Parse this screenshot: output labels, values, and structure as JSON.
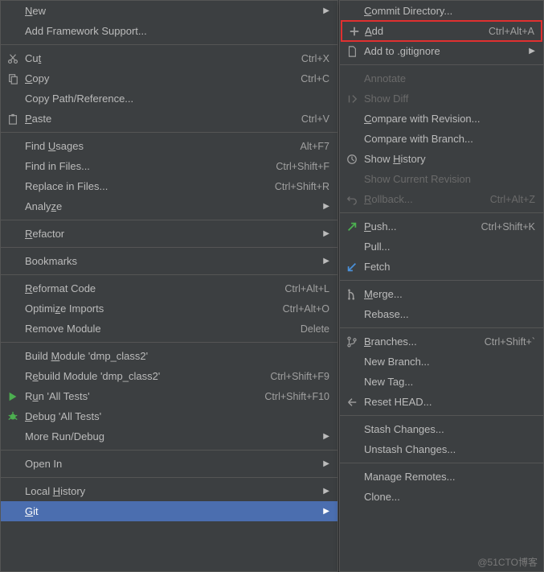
{
  "left_menu": {
    "groups": [
      [
        {
          "id": "new",
          "label": "New",
          "mnemonic": "N",
          "shortcut": "",
          "arrow": true,
          "icon": ""
        },
        {
          "id": "add-framework",
          "label": "Add Framework Support...",
          "mnemonic": "",
          "shortcut": "",
          "arrow": false,
          "icon": ""
        }
      ],
      [
        {
          "id": "cut",
          "label": "Cut",
          "mnemonic": "t",
          "shortcut": "Ctrl+X",
          "arrow": false,
          "icon": "cut"
        },
        {
          "id": "copy",
          "label": "Copy",
          "mnemonic": "C",
          "shortcut": "Ctrl+C",
          "arrow": false,
          "icon": "copy"
        },
        {
          "id": "copy-path",
          "label": "Copy Path/Reference...",
          "mnemonic": "",
          "shortcut": "",
          "arrow": false,
          "icon": ""
        },
        {
          "id": "paste",
          "label": "Paste",
          "mnemonic": "P",
          "shortcut": "Ctrl+V",
          "arrow": false,
          "icon": "paste"
        }
      ],
      [
        {
          "id": "find-usages",
          "label": "Find Usages",
          "mnemonic": "U",
          "shortcut": "Alt+F7",
          "arrow": false,
          "icon": ""
        },
        {
          "id": "find-in-files",
          "label": "Find in Files...",
          "mnemonic": "",
          "shortcut": "Ctrl+Shift+F",
          "arrow": false,
          "icon": ""
        },
        {
          "id": "replace-in-files",
          "label": "Replace in Files...",
          "mnemonic": "",
          "shortcut": "Ctrl+Shift+R",
          "arrow": false,
          "icon": ""
        },
        {
          "id": "analyze",
          "label": "Analyze",
          "mnemonic": "z",
          "shortcut": "",
          "arrow": true,
          "icon": ""
        }
      ],
      [
        {
          "id": "refactor",
          "label": "Refactor",
          "mnemonic": "R",
          "shortcut": "",
          "arrow": true,
          "icon": ""
        }
      ],
      [
        {
          "id": "bookmarks",
          "label": "Bookmarks",
          "mnemonic": "",
          "shortcut": "",
          "arrow": true,
          "icon": ""
        }
      ],
      [
        {
          "id": "reformat",
          "label": "Reformat Code",
          "mnemonic": "R",
          "shortcut": "Ctrl+Alt+L",
          "arrow": false,
          "icon": ""
        },
        {
          "id": "optimize-imports",
          "label": "Optimize Imports",
          "mnemonic": "z",
          "shortcut": "Ctrl+Alt+O",
          "arrow": false,
          "icon": ""
        },
        {
          "id": "remove-module",
          "label": "Remove Module",
          "mnemonic": "",
          "shortcut": "Delete",
          "arrow": false,
          "icon": ""
        }
      ],
      [
        {
          "id": "build-module",
          "label": "Build Module 'dmp_class2'",
          "mnemonic": "M",
          "shortcut": "",
          "arrow": false,
          "icon": ""
        },
        {
          "id": "rebuild-module",
          "label": "Rebuild Module 'dmp_class2'",
          "mnemonic": "e",
          "shortcut": "Ctrl+Shift+F9",
          "arrow": false,
          "icon": ""
        },
        {
          "id": "run-all",
          "label": "Run 'All Tests'",
          "mnemonic": "u",
          "shortcut": "Ctrl+Shift+F10",
          "arrow": false,
          "icon": "run"
        },
        {
          "id": "debug-all",
          "label": "Debug 'All Tests'",
          "mnemonic": "D",
          "shortcut": "",
          "arrow": false,
          "icon": "debug"
        },
        {
          "id": "more-run-debug",
          "label": "More Run/Debug",
          "mnemonic": "",
          "shortcut": "",
          "arrow": true,
          "icon": ""
        }
      ],
      [
        {
          "id": "open-in",
          "label": "Open In",
          "mnemonic": "",
          "shortcut": "",
          "arrow": true,
          "icon": ""
        }
      ],
      [
        {
          "id": "local-history",
          "label": "Local History",
          "mnemonic": "H",
          "shortcut": "",
          "arrow": true,
          "icon": ""
        },
        {
          "id": "git",
          "label": "Git",
          "mnemonic": "G",
          "shortcut": "",
          "arrow": true,
          "icon": "",
          "selected": true
        }
      ]
    ]
  },
  "right_menu": {
    "groups": [
      [
        {
          "id": "commit-dir",
          "label": "Commit Directory...",
          "mnemonic": "C",
          "shortcut": "",
          "arrow": false,
          "icon": ""
        },
        {
          "id": "add",
          "label": "Add",
          "mnemonic": "A",
          "shortcut": "Ctrl+Alt+A",
          "arrow": false,
          "icon": "plus",
          "highlighted": true
        },
        {
          "id": "add-gitignore",
          "label": "Add to .gitignore",
          "mnemonic": "",
          "shortcut": "",
          "arrow": true,
          "icon": "file"
        }
      ],
      [
        {
          "id": "annotate",
          "label": "Annotate",
          "mnemonic": "",
          "shortcut": "",
          "arrow": false,
          "icon": "",
          "disabled": true
        },
        {
          "id": "show-diff",
          "label": "Show Diff",
          "mnemonic": "",
          "shortcut": "",
          "arrow": false,
          "icon": "diff",
          "disabled": true
        },
        {
          "id": "compare-revision",
          "label": "Compare with Revision...",
          "mnemonic": "C",
          "shortcut": "",
          "arrow": false,
          "icon": ""
        },
        {
          "id": "compare-branch",
          "label": "Compare with Branch...",
          "mnemonic": "",
          "shortcut": "",
          "arrow": false,
          "icon": ""
        },
        {
          "id": "show-history",
          "label": "Show History",
          "mnemonic": "H",
          "shortcut": "",
          "arrow": false,
          "icon": "clock"
        },
        {
          "id": "show-current-rev",
          "label": "Show Current Revision",
          "mnemonic": "",
          "shortcut": "",
          "arrow": false,
          "icon": "",
          "disabled": true
        },
        {
          "id": "rollback",
          "label": "Rollback...",
          "mnemonic": "R",
          "shortcut": "Ctrl+Alt+Z",
          "arrow": false,
          "icon": "undo",
          "disabled": true
        }
      ],
      [
        {
          "id": "push",
          "label": "Push...",
          "mnemonic": "P",
          "shortcut": "Ctrl+Shift+K",
          "arrow": false,
          "icon": "push"
        },
        {
          "id": "pull",
          "label": "Pull...",
          "mnemonic": "",
          "shortcut": "",
          "arrow": false,
          "icon": ""
        },
        {
          "id": "fetch",
          "label": "Fetch",
          "mnemonic": "",
          "shortcut": "",
          "arrow": false,
          "icon": "fetch"
        }
      ],
      [
        {
          "id": "merge",
          "label": "Merge...",
          "mnemonic": "M",
          "shortcut": "",
          "arrow": false,
          "icon": "merge"
        },
        {
          "id": "rebase",
          "label": "Rebase...",
          "mnemonic": "",
          "shortcut": "",
          "arrow": false,
          "icon": ""
        }
      ],
      [
        {
          "id": "branches",
          "label": "Branches...",
          "mnemonic": "B",
          "shortcut": "Ctrl+Shift+`",
          "arrow": false,
          "icon": "branch"
        },
        {
          "id": "new-branch",
          "label": "New Branch...",
          "mnemonic": "",
          "shortcut": "",
          "arrow": false,
          "icon": ""
        },
        {
          "id": "new-tag",
          "label": "New Tag...",
          "mnemonic": "",
          "shortcut": "",
          "arrow": false,
          "icon": ""
        },
        {
          "id": "reset-head",
          "label": "Reset HEAD...",
          "mnemonic": "",
          "shortcut": "",
          "arrow": false,
          "icon": "reset"
        }
      ],
      [
        {
          "id": "stash",
          "label": "Stash Changes...",
          "mnemonic": "",
          "shortcut": "",
          "arrow": false,
          "icon": ""
        },
        {
          "id": "unstash",
          "label": "Unstash Changes...",
          "mnemonic": "",
          "shortcut": "",
          "arrow": false,
          "icon": ""
        }
      ],
      [
        {
          "id": "manage-remotes",
          "label": "Manage Remotes...",
          "mnemonic": "",
          "shortcut": "",
          "arrow": false,
          "icon": ""
        },
        {
          "id": "clone",
          "label": "Clone...",
          "mnemonic": "",
          "shortcut": "",
          "arrow": false,
          "icon": ""
        }
      ]
    ]
  },
  "watermark": "@51CTO博客"
}
